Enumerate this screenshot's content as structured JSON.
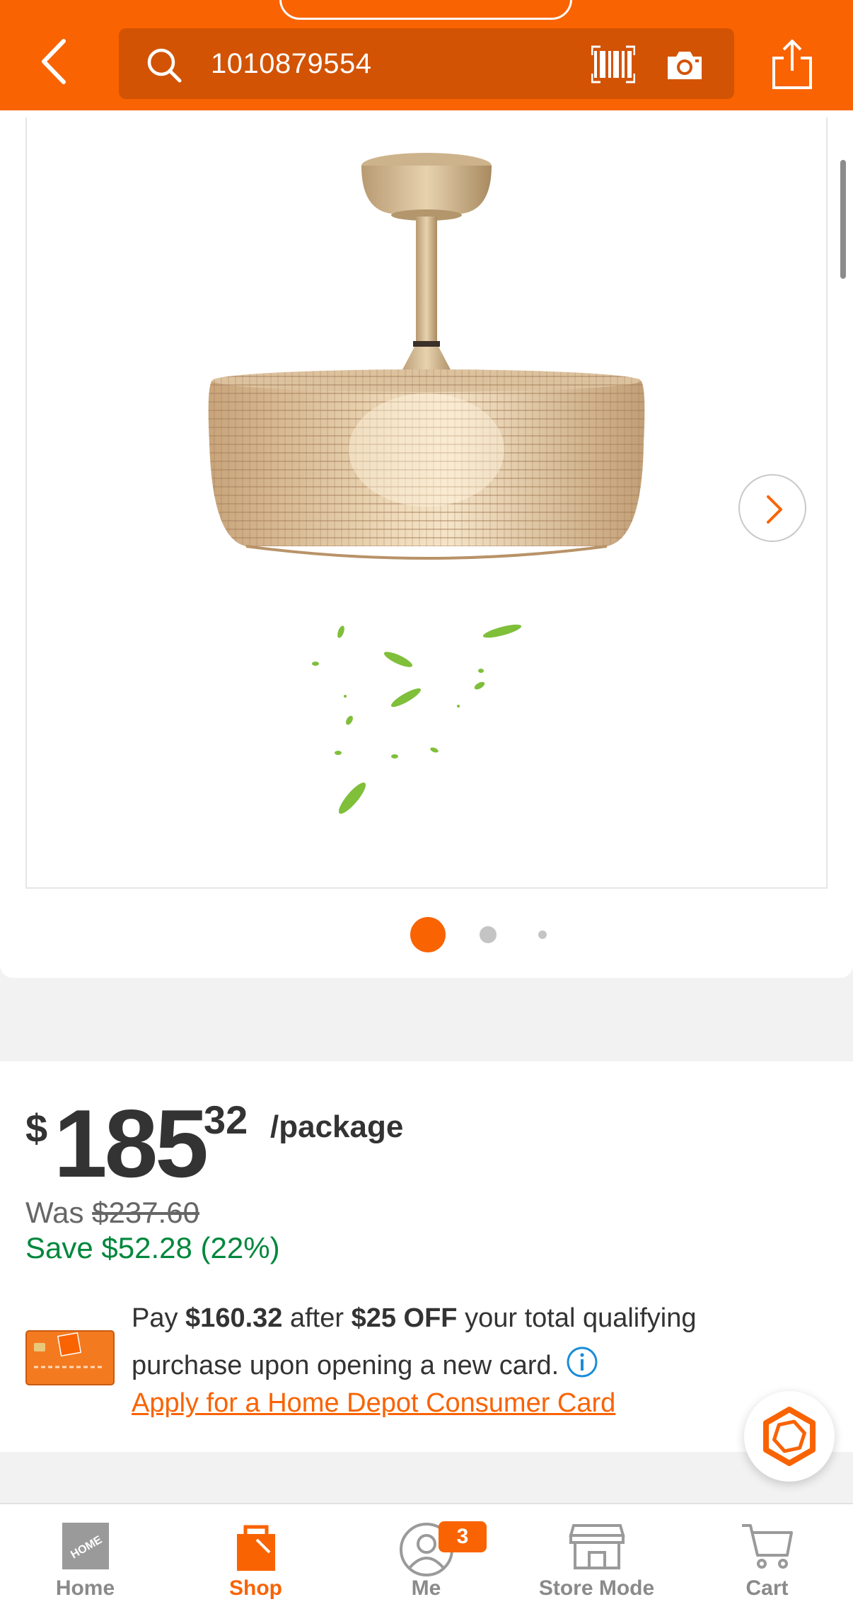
{
  "header": {
    "search_value": "1010879554",
    "back_icon": "chevron-left-icon",
    "search_icon": "search-icon",
    "barcode_icon": "barcode-icon",
    "camera_icon": "camera-icon",
    "share_icon": "share-icon"
  },
  "gallery": {
    "image": "rattan-ceiling-fan-with-leaves",
    "next_icon": "chevron-right-icon",
    "page_count": 3,
    "active_page": 1
  },
  "price": {
    "dollar_sign": "$",
    "dollars": "185",
    "cents": "32",
    "unit": "/package",
    "was_label": "Was ",
    "was_value": "$237.60",
    "save_text": "Save $52.28 (22%)"
  },
  "promo": {
    "pay_prefix": "Pay ",
    "pay_amount": "$160.32",
    "after_text": " after ",
    "discount": "$25 OFF",
    "rest_text": " your total qualifying purchase upon opening a new card.",
    "apply_link": "Apply for a Home Depot Consumer Card"
  },
  "bottom_nav": {
    "items": [
      {
        "label": "Home",
        "icon": "home-depot-logo-icon"
      },
      {
        "label": "Shop",
        "icon": "shop-bag-icon"
      },
      {
        "label": "Me",
        "icon": "user-icon"
      },
      {
        "label": "Store Mode",
        "icon": "store-icon"
      },
      {
        "label": "Cart",
        "icon": "cart-icon"
      }
    ],
    "active": "Shop",
    "me_badge": "3"
  },
  "colors": {
    "brand_orange": "#f96302",
    "search_bg": "#d25304",
    "save_green": "#00873c"
  }
}
